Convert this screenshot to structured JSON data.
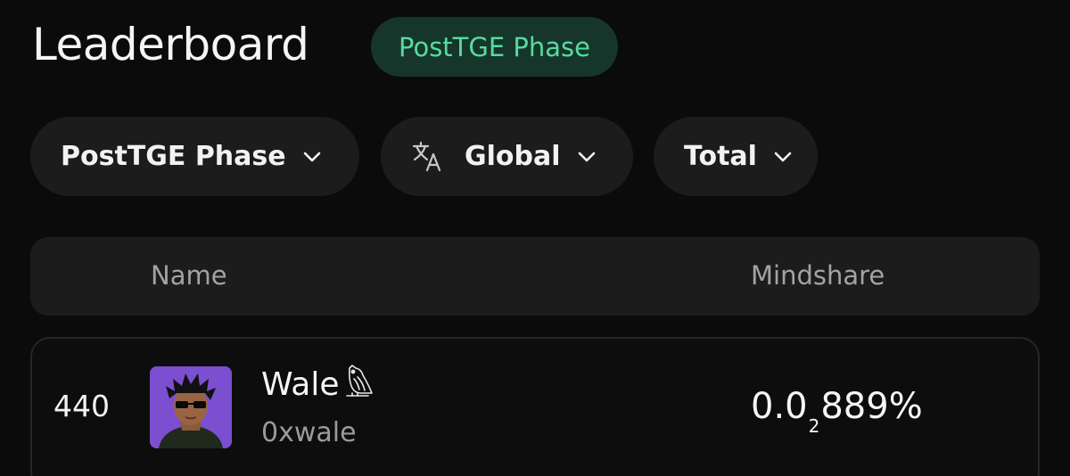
{
  "header": {
    "title": "Leaderboard",
    "phase_badge": "PostTGE Phase"
  },
  "filters": {
    "phase": {
      "label": "PostTGE Phase",
      "icon": "chevron-down-icon"
    },
    "region": {
      "label": "Global",
      "icon": "translate-icon"
    },
    "period": {
      "label": "Total",
      "icon": "chevron-down-icon"
    }
  },
  "table": {
    "columns": {
      "name": "Name",
      "mindshare": "Mindshare"
    },
    "rows": [
      {
        "rank": "440",
        "display_name": "Wale",
        "name_emoji": "owl-icon",
        "handle": "0xwale",
        "mindshare_prefix": "0.0",
        "mindshare_subscript": "2",
        "mindshare_suffix": "889%"
      }
    ]
  },
  "colors": {
    "background": "#0b0b0b",
    "badge_bg": "#16362b",
    "badge_text": "#56dba0",
    "control_bg": "#1c1c1c",
    "muted_text": "#a3a3a3",
    "avatar_bg": "#7b4fcf"
  }
}
